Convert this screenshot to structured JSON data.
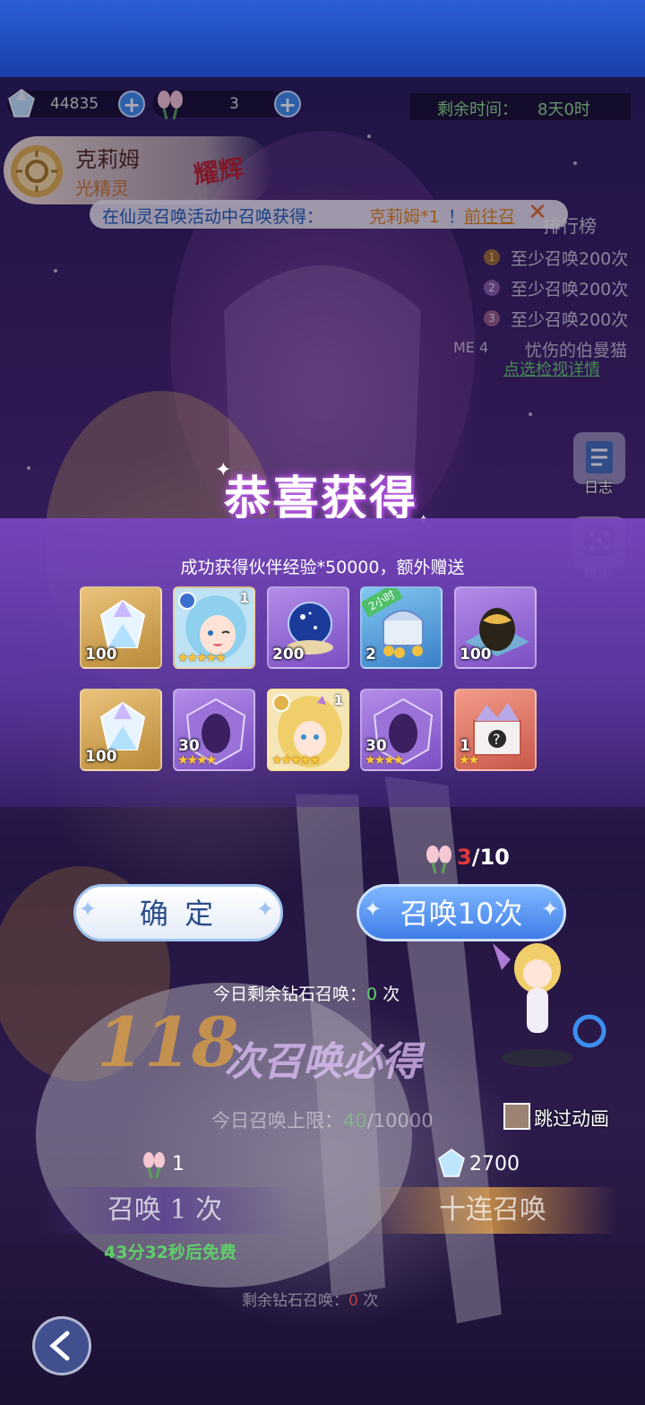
{
  "currency": {
    "diamonds": "44835",
    "tulips": "3"
  },
  "timer": {
    "label": "剩余时间：",
    "value": "8天0时"
  },
  "character": {
    "name": "克莉姆",
    "type": "光精灵",
    "badge": "耀辉"
  },
  "notice": {
    "prefix": "在仙灵召唤活动中召唤获得：",
    "highlight": "克莉姆*1",
    "suffix": "！",
    "link": "前往召"
  },
  "ranking": {
    "title": "排行榜",
    "rows": [
      {
        "rank": "1",
        "text": "至少召唤200次"
      },
      {
        "rank": "2",
        "text": "至少召唤200次"
      },
      {
        "rank": "3",
        "text": "至少召唤200次"
      },
      {
        "rank": "ME 4",
        "text": "忧伤的伯曼猫"
      }
    ],
    "detail_link": "点选检视详情"
  },
  "side": {
    "log_label": "日志",
    "prob_label": "概率"
  },
  "reward": {
    "title": "恭喜获得",
    "subtitle": "成功获得伙伴经验*50000，额外赠送",
    "items_row1": [
      {
        "name": "diamond",
        "qty": "100",
        "quality": "gold"
      },
      {
        "name": "hero-blue-hair",
        "level": "1",
        "stars": "★★★★★",
        "quality": "gold"
      },
      {
        "name": "crystal-orb",
        "qty": "200",
        "quality": "purple"
      },
      {
        "name": "treasure-chest",
        "qty": "2",
        "tag": "2小时",
        "quality": "blue"
      },
      {
        "name": "golden-egg",
        "qty": "100",
        "quality": "purple"
      }
    ],
    "items_row2": [
      {
        "name": "diamond",
        "qty": "100",
        "quality": "gold"
      },
      {
        "name": "purple-shard",
        "qty": "30",
        "stars": "★★★★",
        "quality": "purple"
      },
      {
        "name": "hero-blonde-elf",
        "level": "1",
        "stars": "★★★★★",
        "quality": "gold"
      },
      {
        "name": "purple-shard",
        "qty": "30",
        "stars": "★★★★",
        "quality": "purple"
      },
      {
        "name": "gift-box",
        "qty": "1",
        "stars": "★★",
        "quality": "red"
      }
    ]
  },
  "summon": {
    "tulip_count": "3",
    "tulip_max": "/10",
    "confirm_label": "确 定",
    "summon10_label": "召唤10次",
    "daily_diamond_label": "今日剩余钻石召唤：",
    "daily_diamond_value": "0",
    "daily_diamond_unit": " 次"
  },
  "background_ui": {
    "guarantee_number": "118",
    "guarantee_text": "次召唤必得",
    "limit_label": "今日召唤上限：",
    "limit_current": "40",
    "limit_max": "/10000",
    "skip_label": "跳过动画",
    "single_cost": "1",
    "ten_cost": "2700",
    "single_label": "召唤 1 次",
    "ten_label": "十连召唤",
    "free_timer": "43分32秒后免费",
    "remain_label": "剩余钻石召唤：",
    "remain_value": "0",
    "remain_unit": " 次"
  },
  "colors": {
    "accent_blue": "#3b8ff0",
    "reward_panel": "#7a46be",
    "highlight_orange": "#f0a030",
    "tulip_red": "#e03a3a"
  }
}
